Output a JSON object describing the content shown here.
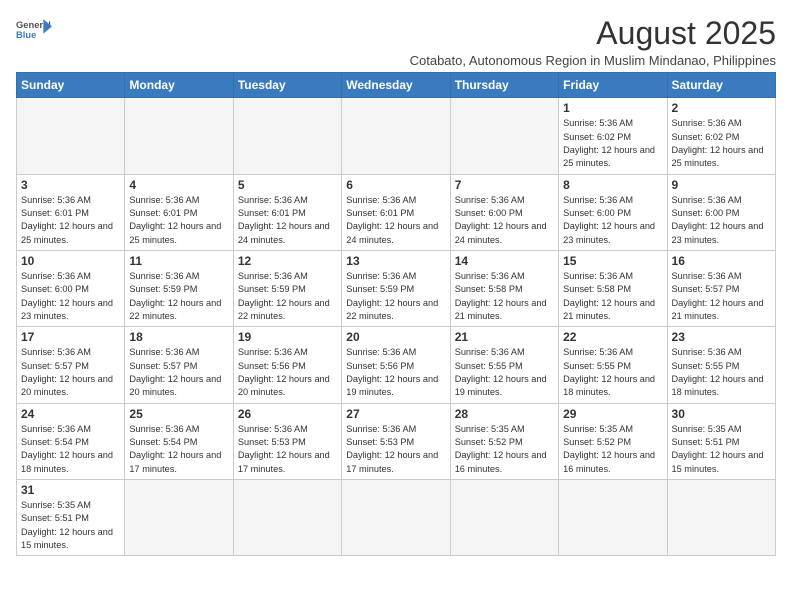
{
  "header": {
    "logo_text_general": "General",
    "logo_text_blue": "Blue",
    "main_title": "August 2025",
    "subtitle": "Cotabato, Autonomous Region in Muslim Mindanao, Philippines"
  },
  "days_of_week": [
    "Sunday",
    "Monday",
    "Tuesday",
    "Wednesday",
    "Thursday",
    "Friday",
    "Saturday"
  ],
  "weeks": [
    [
      {
        "day": "",
        "info": ""
      },
      {
        "day": "",
        "info": ""
      },
      {
        "day": "",
        "info": ""
      },
      {
        "day": "",
        "info": ""
      },
      {
        "day": "",
        "info": ""
      },
      {
        "day": "1",
        "info": "Sunrise: 5:36 AM\nSunset: 6:02 PM\nDaylight: 12 hours and 25 minutes."
      },
      {
        "day": "2",
        "info": "Sunrise: 5:36 AM\nSunset: 6:02 PM\nDaylight: 12 hours and 25 minutes."
      }
    ],
    [
      {
        "day": "3",
        "info": "Sunrise: 5:36 AM\nSunset: 6:01 PM\nDaylight: 12 hours and 25 minutes."
      },
      {
        "day": "4",
        "info": "Sunrise: 5:36 AM\nSunset: 6:01 PM\nDaylight: 12 hours and 25 minutes."
      },
      {
        "day": "5",
        "info": "Sunrise: 5:36 AM\nSunset: 6:01 PM\nDaylight: 12 hours and 24 minutes."
      },
      {
        "day": "6",
        "info": "Sunrise: 5:36 AM\nSunset: 6:01 PM\nDaylight: 12 hours and 24 minutes."
      },
      {
        "day": "7",
        "info": "Sunrise: 5:36 AM\nSunset: 6:00 PM\nDaylight: 12 hours and 24 minutes."
      },
      {
        "day": "8",
        "info": "Sunrise: 5:36 AM\nSunset: 6:00 PM\nDaylight: 12 hours and 23 minutes."
      },
      {
        "day": "9",
        "info": "Sunrise: 5:36 AM\nSunset: 6:00 PM\nDaylight: 12 hours and 23 minutes."
      }
    ],
    [
      {
        "day": "10",
        "info": "Sunrise: 5:36 AM\nSunset: 6:00 PM\nDaylight: 12 hours and 23 minutes."
      },
      {
        "day": "11",
        "info": "Sunrise: 5:36 AM\nSunset: 5:59 PM\nDaylight: 12 hours and 22 minutes."
      },
      {
        "day": "12",
        "info": "Sunrise: 5:36 AM\nSunset: 5:59 PM\nDaylight: 12 hours and 22 minutes."
      },
      {
        "day": "13",
        "info": "Sunrise: 5:36 AM\nSunset: 5:59 PM\nDaylight: 12 hours and 22 minutes."
      },
      {
        "day": "14",
        "info": "Sunrise: 5:36 AM\nSunset: 5:58 PM\nDaylight: 12 hours and 21 minutes."
      },
      {
        "day": "15",
        "info": "Sunrise: 5:36 AM\nSunset: 5:58 PM\nDaylight: 12 hours and 21 minutes."
      },
      {
        "day": "16",
        "info": "Sunrise: 5:36 AM\nSunset: 5:57 PM\nDaylight: 12 hours and 21 minutes."
      }
    ],
    [
      {
        "day": "17",
        "info": "Sunrise: 5:36 AM\nSunset: 5:57 PM\nDaylight: 12 hours and 20 minutes."
      },
      {
        "day": "18",
        "info": "Sunrise: 5:36 AM\nSunset: 5:57 PM\nDaylight: 12 hours and 20 minutes."
      },
      {
        "day": "19",
        "info": "Sunrise: 5:36 AM\nSunset: 5:56 PM\nDaylight: 12 hours and 20 minutes."
      },
      {
        "day": "20",
        "info": "Sunrise: 5:36 AM\nSunset: 5:56 PM\nDaylight: 12 hours and 19 minutes."
      },
      {
        "day": "21",
        "info": "Sunrise: 5:36 AM\nSunset: 5:55 PM\nDaylight: 12 hours and 19 minutes."
      },
      {
        "day": "22",
        "info": "Sunrise: 5:36 AM\nSunset: 5:55 PM\nDaylight: 12 hours and 18 minutes."
      },
      {
        "day": "23",
        "info": "Sunrise: 5:36 AM\nSunset: 5:55 PM\nDaylight: 12 hours and 18 minutes."
      }
    ],
    [
      {
        "day": "24",
        "info": "Sunrise: 5:36 AM\nSunset: 5:54 PM\nDaylight: 12 hours and 18 minutes."
      },
      {
        "day": "25",
        "info": "Sunrise: 5:36 AM\nSunset: 5:54 PM\nDaylight: 12 hours and 17 minutes."
      },
      {
        "day": "26",
        "info": "Sunrise: 5:36 AM\nSunset: 5:53 PM\nDaylight: 12 hours and 17 minutes."
      },
      {
        "day": "27",
        "info": "Sunrise: 5:36 AM\nSunset: 5:53 PM\nDaylight: 12 hours and 17 minutes."
      },
      {
        "day": "28",
        "info": "Sunrise: 5:35 AM\nSunset: 5:52 PM\nDaylight: 12 hours and 16 minutes."
      },
      {
        "day": "29",
        "info": "Sunrise: 5:35 AM\nSunset: 5:52 PM\nDaylight: 12 hours and 16 minutes."
      },
      {
        "day": "30",
        "info": "Sunrise: 5:35 AM\nSunset: 5:51 PM\nDaylight: 12 hours and 15 minutes."
      }
    ],
    [
      {
        "day": "31",
        "info": "Sunrise: 5:35 AM\nSunset: 5:51 PM\nDaylight: 12 hours and 15 minutes."
      },
      {
        "day": "",
        "info": ""
      },
      {
        "day": "",
        "info": ""
      },
      {
        "day": "",
        "info": ""
      },
      {
        "day": "",
        "info": ""
      },
      {
        "day": "",
        "info": ""
      },
      {
        "day": "",
        "info": ""
      }
    ]
  ]
}
